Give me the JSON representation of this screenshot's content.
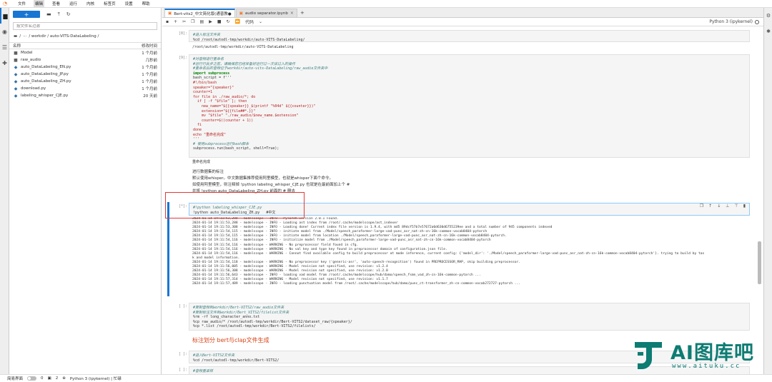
{
  "menubar": {
    "items": [
      "文件",
      "编辑",
      "查看",
      "运行",
      "内核",
      "标签页",
      "设置",
      "帮助"
    ],
    "active_index": 1
  },
  "filebrowser": {
    "new_label": "+",
    "filter_placeholder": "按文件名过滤",
    "breadcrumb": [
      "/",
      "···",
      "/ workdir / auto-VITS-DataLabeling /"
    ],
    "col_name": "名称",
    "col_modified": "修改时间",
    "files": [
      {
        "name": "Model",
        "modified": "1 个月前",
        "icon": "folder-icon"
      },
      {
        "name": "raw_audio",
        "modified": "几秒前",
        "icon": "folder-icon"
      },
      {
        "name": "auto_DataLabeling_EN.py",
        "modified": "1 个月前",
        "icon": "python-file-icon"
      },
      {
        "name": "auto_DataLabeling_JP.py",
        "modified": "1 个月前",
        "icon": "python-file-icon"
      },
      {
        "name": "auto_DataLabeling_ZH.py",
        "modified": "1 个月前",
        "icon": "python-file-icon"
      },
      {
        "name": "download.py",
        "modified": "1 个月前",
        "icon": "python-file-icon"
      },
      {
        "name": "labeling_whisper_CJE.py",
        "modified": "20 天前",
        "icon": "python-file-icon"
      }
    ]
  },
  "tabs": [
    {
      "label": "Bert-vits2_中文简化版(通普教●",
      "active": true
    },
    {
      "label": "audio separator.ipynb",
      "active": false
    }
  ],
  "toolbar": {
    "cell_type": "代码",
    "kernel_name": "Python 3 (ipykernel)"
  },
  "cells": [
    {
      "prompt": "[8]:",
      "code_lines": [
        {
          "t": "#进入标注文件夹",
          "c": "cm"
        },
        {
          "t": "%cd /root/autodl-tmp/workdir/auto-VITS-DataLabeling/",
          "c": ""
        }
      ],
      "output": "/root/autodl-tmp/workdir/auto-VITS-DataLabeling"
    },
    {
      "prompt": "[9]:",
      "code_lines": [
        {
          "t": "#对音频进行重命名",
          "c": "cm"
        },
        {
          "t": "#运行行此步之前，请确保您已经准备好运行过一次该过入的操作",
          "c": "cm"
        },
        {
          "t": "#重命名后的音频位于workdir/auto-vits-DataLabeling/raw_audio文件夹中",
          "c": "cm"
        },
        {
          "t": "import subprocess",
          "c": "kw"
        },
        {
          "t": "bash_script = f'''",
          "c": ""
        },
        {
          "t": "#!/bin/bash",
          "c": "st"
        },
        {
          "t": "speaker=\"{speaker}\"",
          "c": "st"
        },
        {
          "t": "counter=1",
          "c": "st"
        },
        {
          "t": "for file in ./raw_audio/*; do",
          "c": "st"
        },
        {
          "t": "  if [ -f \"$file\" ]; then",
          "c": "st"
        },
        {
          "t": "    new_name=\"${{speaker}}_$(printf \"%04d\" ${{counter}})\"",
          "c": "st"
        },
        {
          "t": "    extension=\"${{file##*.}}\"",
          "c": "st"
        },
        {
          "t": "    mv \"$file\" \"./raw_audio/$new_name.$extension\"",
          "c": "st"
        },
        {
          "t": "    counter=$((counter + 1))",
          "c": "st"
        },
        {
          "t": "  fi",
          "c": "st"
        },
        {
          "t": "done",
          "c": "st"
        },
        {
          "t": "echo \"重命名完成\"",
          "c": "st"
        },
        {
          "t": "'''",
          "c": "st"
        },
        {
          "t": "# 使用subprocess运行bash脚本",
          "c": "cm"
        },
        {
          "t": "subprocess.run(bash_script, shell=True);",
          "c": ""
        }
      ],
      "output": "重命名完成"
    },
    {
      "markdown_lines": [
        "进行数据集的标注",
        "默认使用whisper。中文数据集推荐使用阿里模型，也就是whisper下面个命令。",
        "如使用阿里模型，则注释掉 !python labeling_whisper_CJE.py 也就是在最前面加上个 #",
        "并将 !python auto_DataLabeling_ZH.py 前面的 # 删去"
      ]
    },
    {
      "prompt": "[*]:",
      "code_lines": [
        {
          "t": "#!python labeling_whisper_CJE.py",
          "c": "cm"
        },
        {
          "t": "!python auto_DataLabeling_ZH.py   #中文",
          "c": ""
        }
      ],
      "stderr": [
        "2024-01-14 19:11:53,288 - modelscope - INFO - PyTorch version 2.0.1 Found.",
        "2024-01-14 19:11:53,288 - modelscope - INFO - Loading ast index from /root/.cache/modelscope/ast_indexer",
        "2024-01-14 19:11:53,308 - modelscope - INFO - Loading done! Current index file version is 1.9.4, with md5 89dcf57b7e57672a0d630d6755239ee and a total number of 945 components indexed",
        "2024-01-14 19:11:54,115 - modelscope - INFO - initiate model from ./Model/speech_paraformer-large-vad-punc_asr_nat-zh-cn-16k-common-vocab8404-pytorch",
        "2024-01-14 19:11:54,115 - modelscope - INFO - initiate model from location ./Model/speech_paraformer-large-vad-punc_asr_nat-zh-cn-16k-common-vocab8404-pytorch.",
        "2024-01-14 19:11:54,116 - modelscope - INFO - initialize model from ./Model/speech_paraformer-large-vad-punc_asr_nat-zh-cn-16k-common-vocab8404-pytorch",
        "2024-01-14 19:11:54,116 - modelscope - WARNING - No preprocessor field found in cfg.",
        "2024-01-14 19:11:54,116 - modelscope - WARNING - No val key and type key found in preprocessor domain of configuration.json file.",
        "2024-01-14 19:11:54,116 - modelscope - WARNING - Cannot find available config to build preprocessor at mode inference, current config: {'model_dir': './Model/speech_paraformer-large-vad-punc_asr_nat-zh-cn-16k-common-vocab8404-pytorch'}. trying to build by tas",
        "k and model information.",
        "2024-01-14 19:11:54,118 - modelscope - WARNING - No preprocessor key ('generic-asr', 'auto-speech-recognition') found in PREPROCESSOR_MAP, skip building preprocessor.",
        "2024-01-14 19:11:56,005 - modelscope - WARNING - Model revision not specified, use revision: v1.2.4",
        "2024-01-14 19:11:56,308 - modelscope - WARNING - Model revision not specified, use revision: v1.2.0",
        "2024-01-14 19:11:56,643 - modelscope - INFO - loading vad model from /root/.cache/modelscope/hub/damo/speech_fsmn_vad_zh-cn-16k-common-pytorch ...",
        "2024-01-14 19:11:57,314 - modelscope - WARNING - Model revision not specified, use revision: v1.1.7",
        "2024-01-14 19:11:57,489 - modelscope - INFO - loading punctuation model from /root/.cache/modelscope/hub/damo/punc_ct-transformer_zh-cn-common-vocab272727-pytorch ..."
      ]
    },
    {
      "prompt": "[ ]:",
      "code_lines": [
        {
          "t": "#复制音频到workdir/Bert-VITS2/raw_audio文件夹",
          "c": "cm"
        },
        {
          "t": "#复制标注文件到workdir/Bert_VITS2/filelist文件夹",
          "c": "cm"
        },
        {
          "t": "%rm -rf long_character_anno.txt",
          "c": ""
        },
        {
          "t": "%cp raw_audio/* /root/autodl-tmp/workdir/Bert-VITS2/dataset_raw/{speaker}/",
          "c": ""
        },
        {
          "t": "%cp *.list /root/autodl-tmp/workdir/Bert-VITS2/filelists/",
          "c": ""
        }
      ]
    },
    {
      "heading": "标注划分 bert与clap文件生成"
    },
    {
      "prompt": "[ ]:",
      "code_lines": [
        {
          "t": "#进入Bert-VITS2文件夹",
          "c": "cm"
        },
        {
          "t": "%cd /root/autodl-tmp/workdir/Bert-VITS2/",
          "c": ""
        }
      ]
    },
    {
      "prompt": "[ ]:",
      "code_lines": [
        {
          "t": "#音频重采样",
          "c": "cm"
        }
      ]
    }
  ],
  "statusbar": {
    "simple_mode": "简易界面",
    "count_a": "0",
    "count_b": "2",
    "kernel_status": "Python 3 (ipykernel) | 忙碌"
  },
  "watermark": {
    "title": "AI图库吧",
    "url": "www.aituku.cc"
  },
  "colors": {
    "accent": "#1976d2",
    "highlight_box": "#e53935",
    "heading": "#d84315",
    "watermark": "#0d7c73"
  }
}
